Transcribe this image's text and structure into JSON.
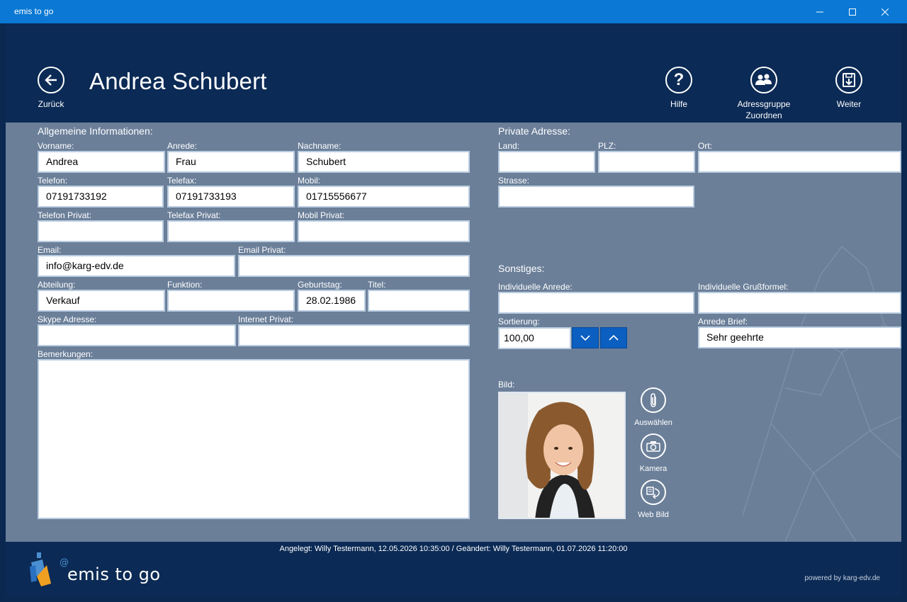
{
  "window": {
    "title": "emis to go",
    "minimize": "—",
    "maximize": "☐",
    "close": "✕"
  },
  "header": {
    "back_label": "Zurück",
    "title": "Andrea Schubert",
    "help_label": "Hilfe",
    "group_label_1": "Adressgruppe",
    "group_label_2": "Zuordnen",
    "next_label": "Weiter"
  },
  "general": {
    "title": "Allgemeine Informationen:",
    "vorname": {
      "label": "Vorname:",
      "value": "Andrea"
    },
    "anrede": {
      "label": "Anrede:",
      "value": "Frau"
    },
    "nachname": {
      "label": "Nachname:",
      "value": "Schubert"
    },
    "telefon": {
      "label": "Telefon:",
      "value": "07191733192"
    },
    "telefax": {
      "label": "Telefax:",
      "value": "07191733193"
    },
    "mobil": {
      "label": "Mobil:",
      "value": "01715556677"
    },
    "telefon_privat": {
      "label": "Telefon Privat:",
      "value": ""
    },
    "telefax_privat": {
      "label": "Telefax Privat:",
      "value": ""
    },
    "mobil_privat": {
      "label": "Mobil Privat:",
      "value": ""
    },
    "email": {
      "label": "Email:",
      "value": "info@karg-edv.de"
    },
    "email_privat": {
      "label": "Email Privat:",
      "value": ""
    },
    "abteilung": {
      "label": "Abteilung:",
      "value": "Verkauf"
    },
    "funktion": {
      "label": "Funktion:",
      "value": ""
    },
    "geburtstag": {
      "label": "Geburtstag:",
      "value": "28.02.1986"
    },
    "titel": {
      "label": "Titel:",
      "value": ""
    },
    "skype": {
      "label": "Skype Adresse:",
      "value": ""
    },
    "internet_privat": {
      "label": "Internet Privat:",
      "value": ""
    },
    "bemerkungen": {
      "label": "Bemerkungen:",
      "value": ""
    }
  },
  "private_address": {
    "title": "Private Adresse:",
    "land": {
      "label": "Land:",
      "value": ""
    },
    "plz": {
      "label": "PLZ:",
      "value": ""
    },
    "ort": {
      "label": "Ort:",
      "value": ""
    },
    "strasse": {
      "label": "Strasse:",
      "value": ""
    }
  },
  "misc": {
    "title": "Sonstiges:",
    "individuelle_anrede": {
      "label": "Individuelle Anrede:",
      "value": ""
    },
    "individuelle_grussformel": {
      "label": "Individuelle Grußformel:",
      "value": ""
    },
    "sortierung": {
      "label": "Sortierung:",
      "value": "100,00"
    },
    "anrede_brief": {
      "label": "Anrede Brief:",
      "value": "Sehr geehrte"
    }
  },
  "image": {
    "label": "Bild:",
    "select_label": "Auswählen",
    "camera_label": "Kamera",
    "web_label": "Web Bild"
  },
  "footer": {
    "meta": "Angelegt: Willy Testermann, 12.05.2026 10:35:00  /  Geändert: Willy Testermann, 01.07.2026 11:20:00",
    "logo_text": "emis to go",
    "powered": "powered by karg-edv.de"
  },
  "colors": {
    "titlebar": "#0a78d4",
    "header_bg": "#0b2a55",
    "content_bg": "#6b7f99",
    "spin_button": "#0a5fc0"
  }
}
